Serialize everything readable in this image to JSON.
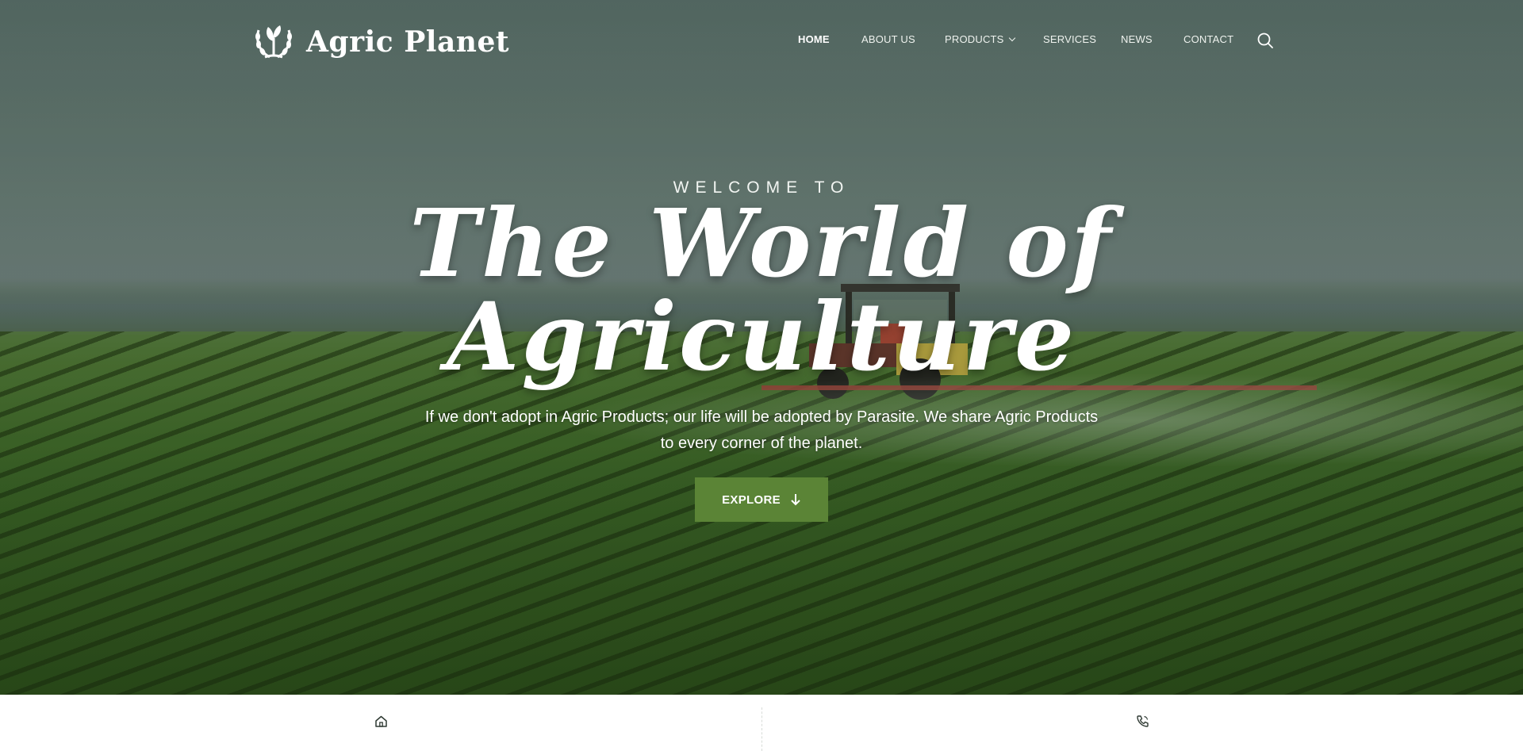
{
  "brand": {
    "name": "Agric Planet",
    "logo_icon": "wreath-sprout-logo"
  },
  "nav": {
    "items": [
      {
        "label": "HOME",
        "active": true
      },
      {
        "label": "ABOUT US",
        "active": false
      },
      {
        "label": "PRODUCTS",
        "active": false,
        "has_dropdown": true
      },
      {
        "label": "SERVICES",
        "active": false
      },
      {
        "label": "NEWS",
        "active": false
      },
      {
        "label": "CONTACT",
        "active": false
      }
    ],
    "search_icon": "search-icon"
  },
  "hero": {
    "kicker": "WELCOME TO",
    "headline_line1": "The World of",
    "headline_line2": "Agriculture",
    "subtext_line1": "If we don't adopt in Agric Products; our life will be adopted by Parasite. We share Agric Products",
    "subtext_line2": "to every corner of the planet.",
    "cta_label": "EXPLORE",
    "cta_icon": "arrow-down-icon"
  },
  "infobar": {
    "left_icon": "home-icon",
    "right_icon": "phone-icon"
  },
  "colors": {
    "accent": "#5b8436",
    "text_light": "#ffffff",
    "divider": "#d8dcd8"
  }
}
